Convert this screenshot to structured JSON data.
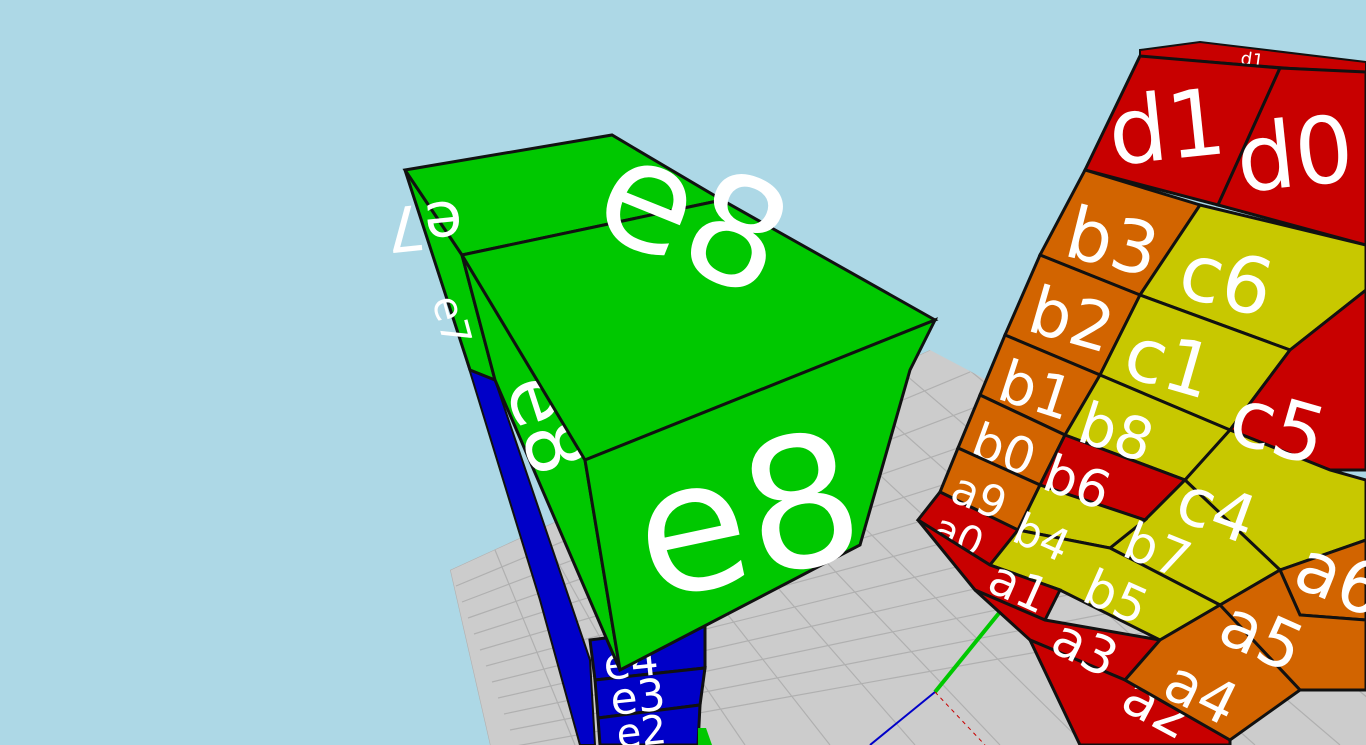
{
  "scene": {
    "background_color": "#add8e6",
    "floor_color": "#cccccc",
    "floor_grid_color": "#b0b0b0",
    "edge_color": "#111111",
    "label_color": "#ffffff"
  },
  "palette": {
    "green": "#00c800",
    "blue": "#0000c8",
    "red": "#c80000",
    "orange": "#d26400",
    "yellow": "#c8c800"
  },
  "axes": {
    "x_color": "#c80000",
    "y_color": "#00c800",
    "z_color": "#0000c8"
  },
  "column_cubes": {
    "top_back": "e7",
    "top_front": "e8",
    "front_face": "e8",
    "left_face": "e8",
    "left_back_face": "e7",
    "blue_labels": [
      "e4",
      "e3",
      "e2"
    ]
  },
  "wall_cubes": {
    "top_row": [
      "d1",
      "d0"
    ],
    "top_edge_hint": "d1",
    "column_b_upper": [
      "b3",
      "b2",
      "b1",
      "b0"
    ],
    "column_a_left": [
      "a9",
      "a0"
    ],
    "c_labels": [
      "c6",
      "c1",
      "c5",
      "c4"
    ],
    "b_labels": [
      "b8",
      "b6",
      "b7",
      "b4",
      "b5"
    ],
    "bottom_row": [
      "a1",
      "a3",
      "a2"
    ],
    "right_column": [
      "a6",
      "a5",
      "a4"
    ]
  }
}
